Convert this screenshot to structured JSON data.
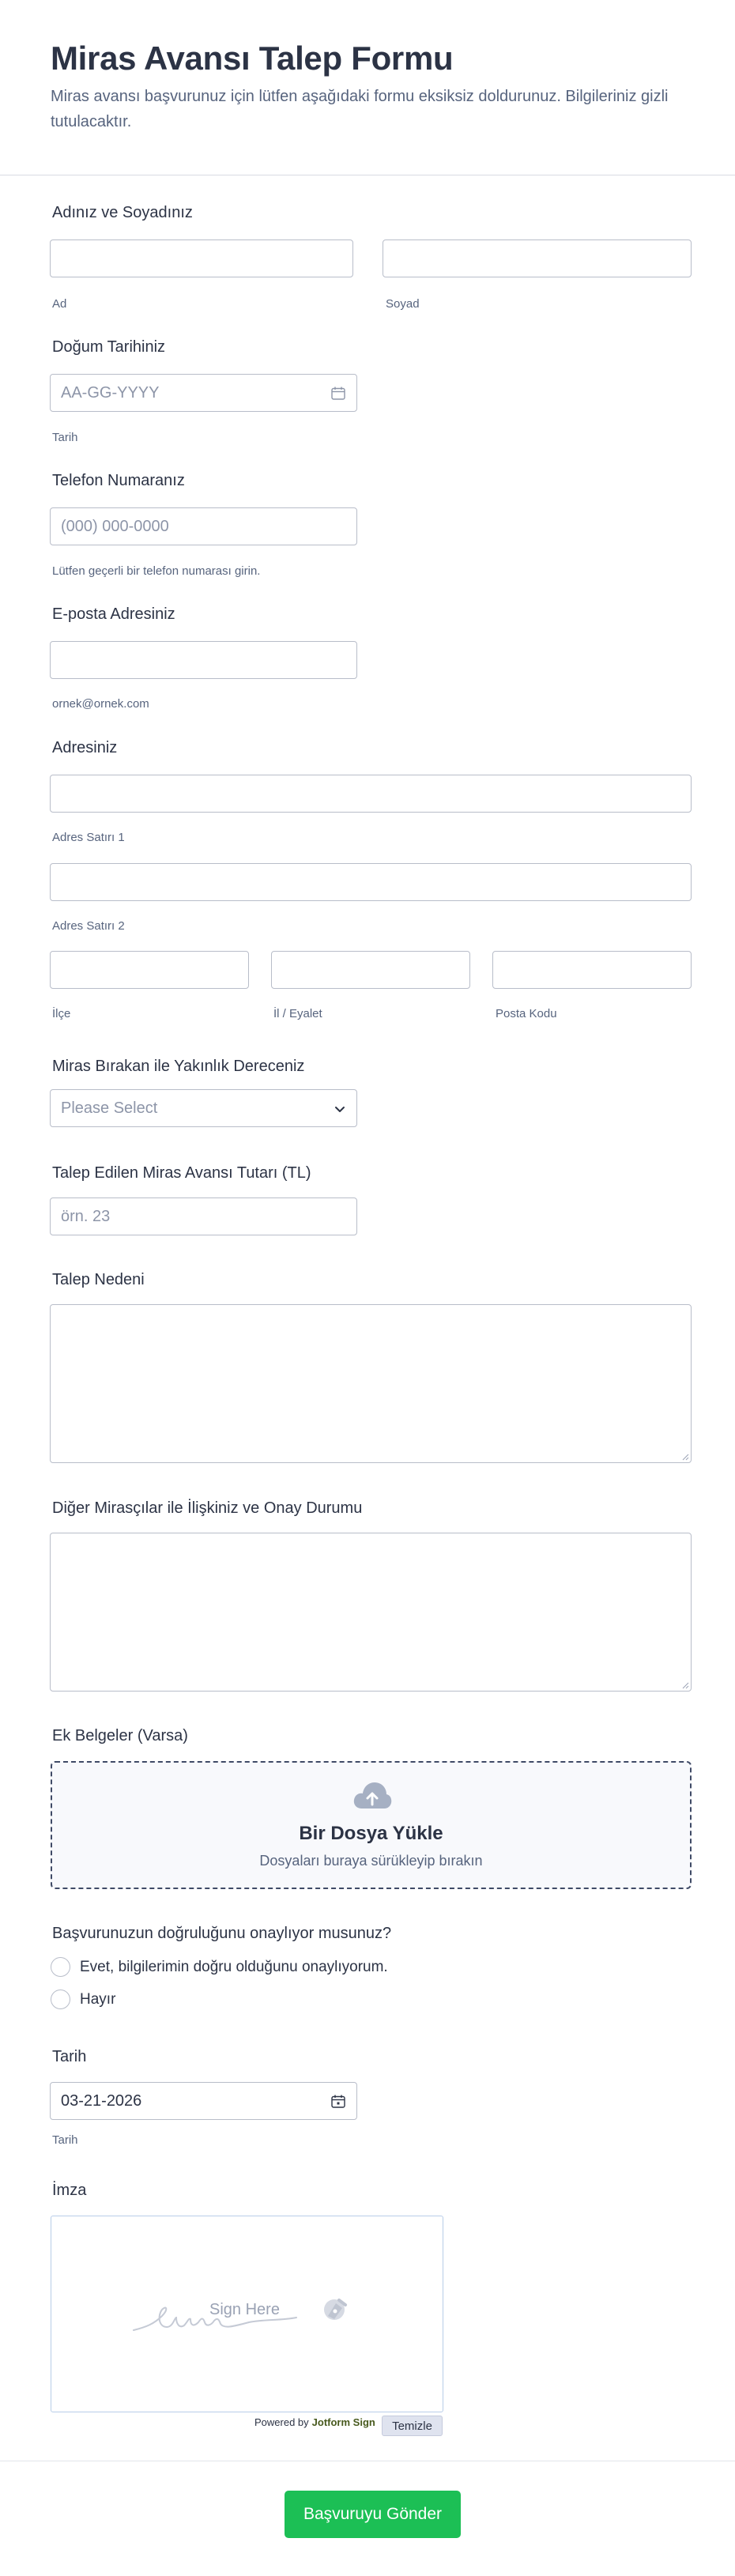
{
  "header": {
    "title": "Miras Avansı Talep Formu",
    "description": "Miras avansı başvurunuz için lütfen aşağıdaki formu eksiksiz doldurunuz. Bilgileriniz gizli tutulacaktır."
  },
  "name": {
    "label": "Adınız ve Soyadınız",
    "first_value": "",
    "last_value": "",
    "first_sublabel": "Ad",
    "last_sublabel": "Soyad"
  },
  "birthdate": {
    "label": "Doğum Tarihiniz",
    "placeholder": "AA-GG-YYYY",
    "sublabel": "Tarih"
  },
  "phone": {
    "label": "Telefon Numaranız",
    "placeholder": "(000) 000-0000",
    "sublabel": "Lütfen geçerli bir telefon numarası girin."
  },
  "email": {
    "label": "E-posta Adresiniz",
    "value": "",
    "sublabel": "ornek@ornek.com"
  },
  "address": {
    "label": "Adresiniz",
    "line1_sublabel": "Adres Satırı 1",
    "line2_sublabel": "Adres Satırı 2",
    "district_sublabel": "İlçe",
    "province_sublabel": "İl / Eyalet",
    "postal_sublabel": "Posta Kodu"
  },
  "relation": {
    "label": "Miras Bırakan ile Yakınlık Dereceniz",
    "selected": "Please Select"
  },
  "amount": {
    "label": "Talep Edilen Miras Avansı Tutarı (TL)",
    "placeholder": "örn. 23"
  },
  "reason": {
    "label": "Talep Nedeni",
    "value": ""
  },
  "heirs": {
    "label": "Diğer Mirasçılar ile İlişkiniz ve Onay Durumu",
    "value": ""
  },
  "documents": {
    "label": "Ek Belgeler (Varsa)",
    "upload_title": "Bir Dosya Yükle",
    "upload_subtitle": "Dosyaları buraya sürükleyip bırakın"
  },
  "confirm": {
    "label": "Başvurunuzun doğruluğunu onaylıyor musunuz?",
    "options": [
      "Evet, bilgilerimin doğru olduğunu onaylıyorum.",
      "Hayır"
    ]
  },
  "date": {
    "label": "Tarih",
    "value": "03-21-2026",
    "sublabel": "Tarih"
  },
  "signature": {
    "label": "İmza",
    "placeholder": "Sign Here",
    "powered_prefix": "Powered by",
    "powered_brand": "Jotform Sign",
    "clear_label": "Temizle"
  },
  "submit": {
    "label": "Başvuruyu Gönder"
  },
  "colors": {
    "submit_bg": "#1cbf55",
    "text": "#2c3345",
    "border": "#b8bdc9"
  },
  "icons": [
    "calendar-icon",
    "chevron-down-icon",
    "upload-cloud-icon",
    "signature-pen-icon"
  ]
}
